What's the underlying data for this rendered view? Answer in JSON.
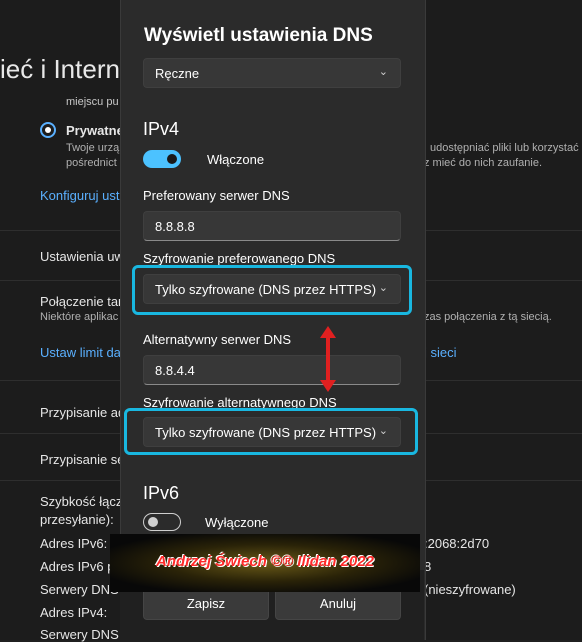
{
  "background": {
    "title": "ieć i Intern",
    "radio_prev_text": "miejscu pu",
    "radio_label": "Prywatne",
    "radio_desc_1": "Twoje urzą",
    "radio_desc_1b": "udostępniać pliki lub korzystać",
    "radio_desc_2": "pośrednict",
    "radio_desc_2b": "z mieć do nich zaufanie.",
    "configure_link": "Konfiguruj ust",
    "settings_row": "Ustawienia uw",
    "metered_title": "Połączenie tar",
    "metered_desc": "Niektóre aplikac",
    "metered_desc_b": "zas połączenia z tą siecią.",
    "limit_link": "Ustaw limit da",
    "limit_link_b": "j sieci",
    "assign_ip": "Przypisanie ad",
    "assign_dns": "Przypisanie se",
    "speed_1": "Szybkość łącz",
    "speed_2": "przesyłanie):",
    "ipv6_addr": "Adres IPv6:",
    "ipv6_addr_val": ":2068:2d70",
    "ipv6_prefix": "Adres IPv6 p",
    "ipv6_prefix_val": "8",
    "dns_servers": "Serwery DNS I",
    "dns_servers_val": "(nieszyfrowane)",
    "ipv4_addr": "Adres IPv4:",
    "dns_servers_2": "Serwery DNS I"
  },
  "dialog": {
    "title": "Wyświetl ustawienia DNS",
    "mode_select": "Ręczne",
    "ipv4": {
      "heading": "IPv4",
      "toggle_label": "Włączone",
      "toggle_on": true,
      "preferred_label": "Preferowany serwer DNS",
      "preferred_value": "8.8.8.8",
      "preferred_enc_label": "Szyfrowanie preferowanego DNS",
      "preferred_enc_value": "Tylko szyfrowane (DNS przez HTTPS)",
      "alternate_label": "Alternatywny serwer DNS",
      "alternate_value": "8.8.4.4",
      "alternate_enc_label": "Szyfrowanie alternatywnego DNS",
      "alternate_enc_value": "Tylko szyfrowane (DNS przez HTTPS)"
    },
    "ipv6": {
      "heading": "IPv6",
      "toggle_label": "Wyłączone",
      "toggle_on": false
    },
    "save_label": "Zapisz",
    "cancel_label": "Anuluj"
  },
  "watermark": "Andrzej Świech ©® Ilidan 2022",
  "colors": {
    "accent": "#4cc2ff",
    "highlight_box": "#19b7e0",
    "annotation_arrow": "#e02020"
  },
  "icons": [
    "chevron-down-icon",
    "double-arrow-annotation-icon"
  ]
}
